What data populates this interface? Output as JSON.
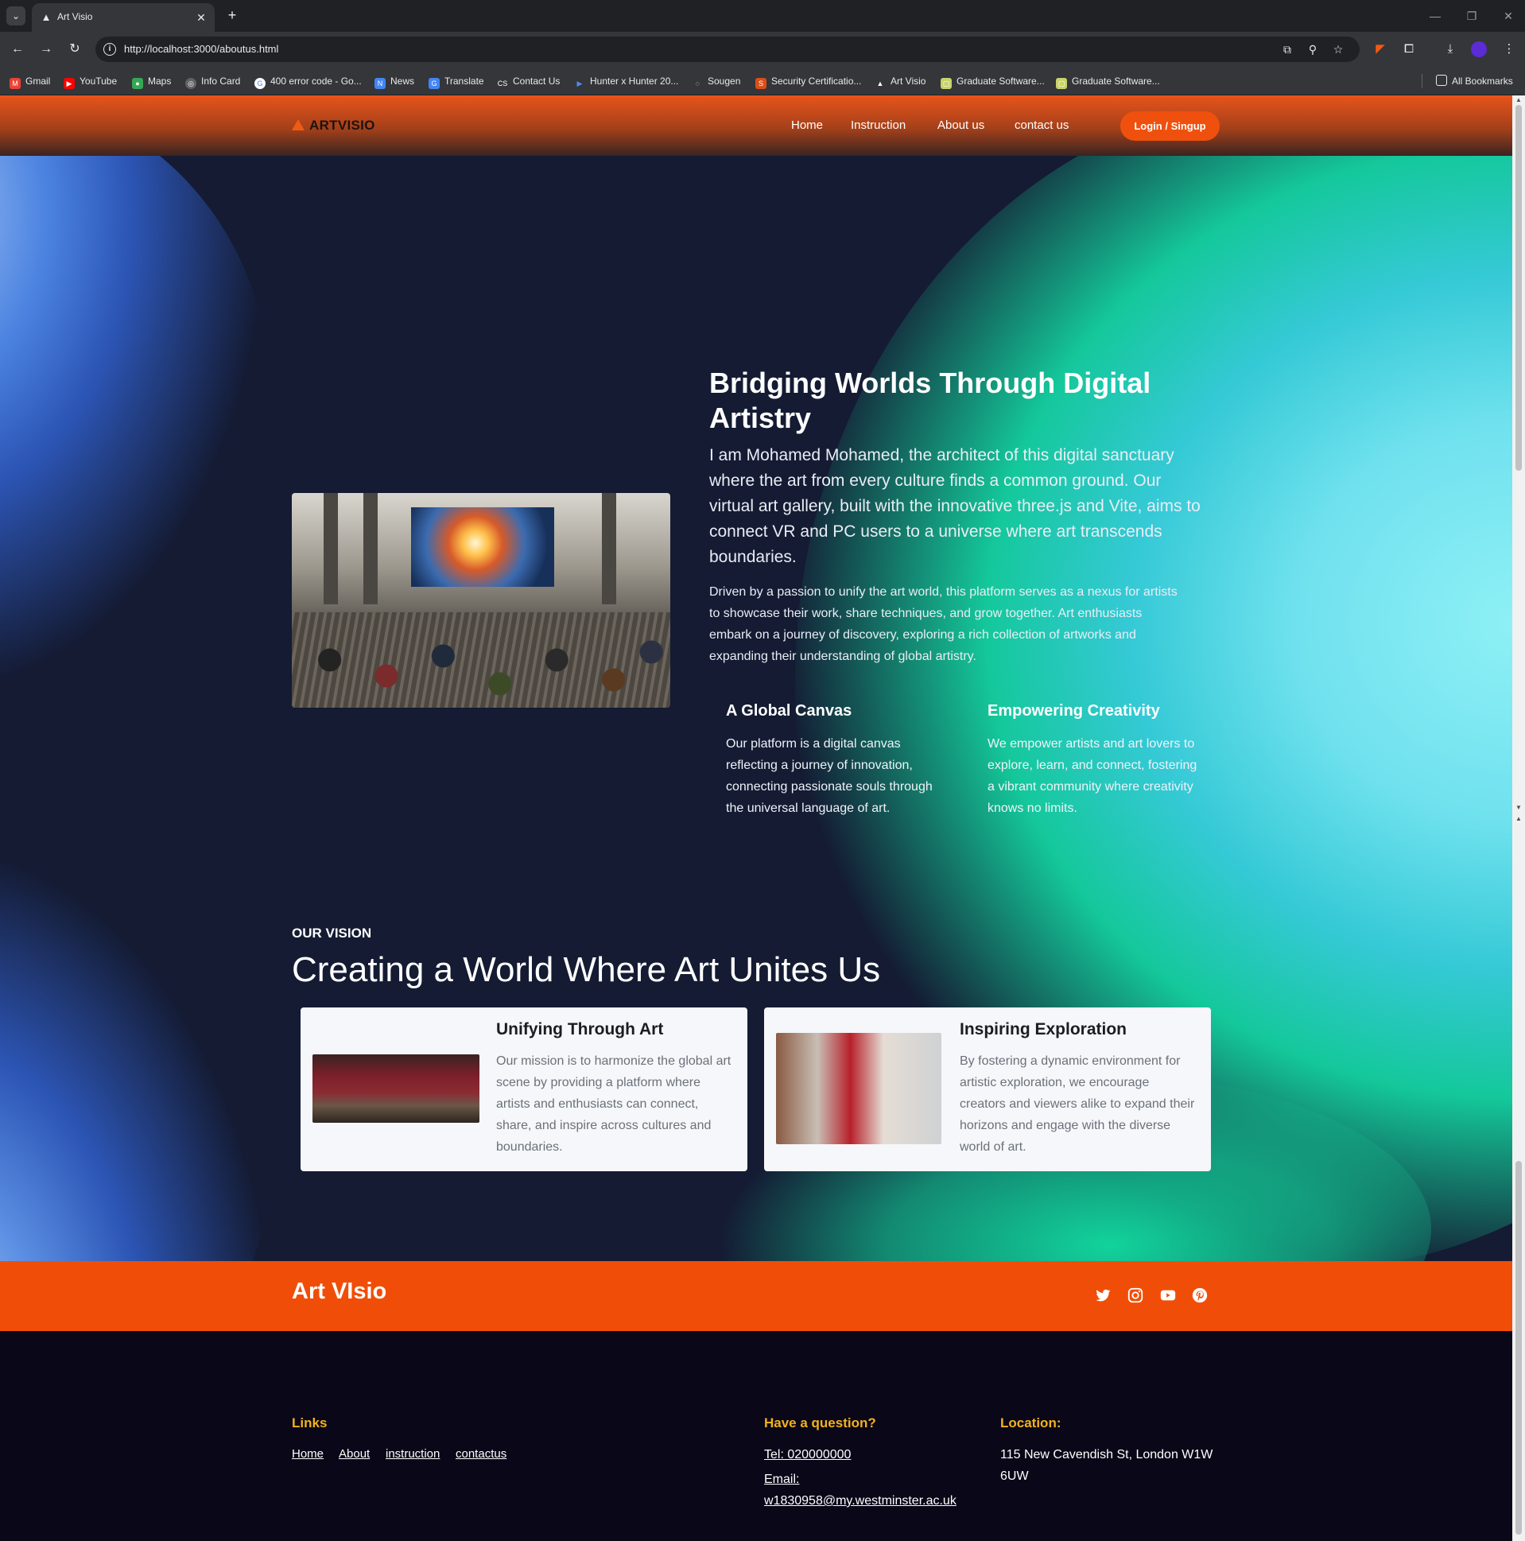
{
  "browser": {
    "tab_title": "Art Visio",
    "url": "http://localhost:3000/aboutus.html",
    "bookmarks": [
      "Gmail",
      "YouTube",
      "Maps",
      "Info Card",
      "400 error code - Go...",
      "News",
      "Translate",
      "Contact Us",
      "Hunter x Hunter 20...",
      "Sougen",
      "Security Certificatio...",
      "Art Visio",
      "Graduate Software...",
      "Graduate Software..."
    ],
    "all_bookmarks": "All Bookmarks"
  },
  "nav": {
    "logo": "ARTVISIO",
    "links": [
      "Home",
      "Instruction",
      "About us",
      "contact us"
    ],
    "login": "Login / Singup"
  },
  "about": {
    "title": "Bridging Worlds Through Digital Artistry",
    "lead": "I am Mohamed Mohamed, the architect of this digital sanctuary where the art from every culture finds a common ground. Our virtual art gallery, built with the innovative three.js and Vite, aims to connect VR and PC users to a universe where art transcends boundaries.",
    "body": "Driven by a passion to unify the art world, this platform serves as a nexus for artists to showcase their work, share techniques, and grow together. Art enthusiasts embark on a journey of discovery, exploring a rich collection of artworks and expanding their understanding of global artistry.",
    "features": [
      {
        "title": "A Global Canvas",
        "text": "Our platform is a digital canvas reflecting a journey of innovation, connecting passionate souls through the universal language of art."
      },
      {
        "title": "Empowering Creativity",
        "text": "We empower artists and art lovers to explore, learn, and connect, fostering a vibrant community where creativity knows no limits."
      }
    ]
  },
  "vision": {
    "kicker": "OUR VISION",
    "title": "Creating a World Where Art Unites Us",
    "cards": [
      {
        "title": "Unifying Through Art",
        "text": "Our mission is to harmonize the global art scene by providing a platform where artists and enthusiasts can connect, share, and inspire across cultures and boundaries."
      },
      {
        "title": "Inspiring Exploration",
        "text": "By fostering a dynamic environment for artistic exploration, we encourage creators and viewers alike to expand their horizons and engage with the diverse world of art."
      }
    ]
  },
  "footer": {
    "brand": "Art VIsio",
    "social": [
      "twitter-icon",
      "instagram-icon",
      "youtube-icon",
      "pinterest-icon"
    ],
    "links_heading": "Links",
    "links": [
      "Home",
      "About",
      "instruction",
      "contactus"
    ],
    "question_heading": "Have a question?",
    "tel": "Tel: 020000000",
    "email_label": "Email:",
    "email": "w1830958@my.westminster.ac.uk",
    "location_heading": "Location:",
    "location": "115 New Cavendish St, London W1W 6UW"
  },
  "colors": {
    "accent": "#f04e08",
    "footer_heading": "#f2b11d",
    "page_bg": "#141b33"
  }
}
